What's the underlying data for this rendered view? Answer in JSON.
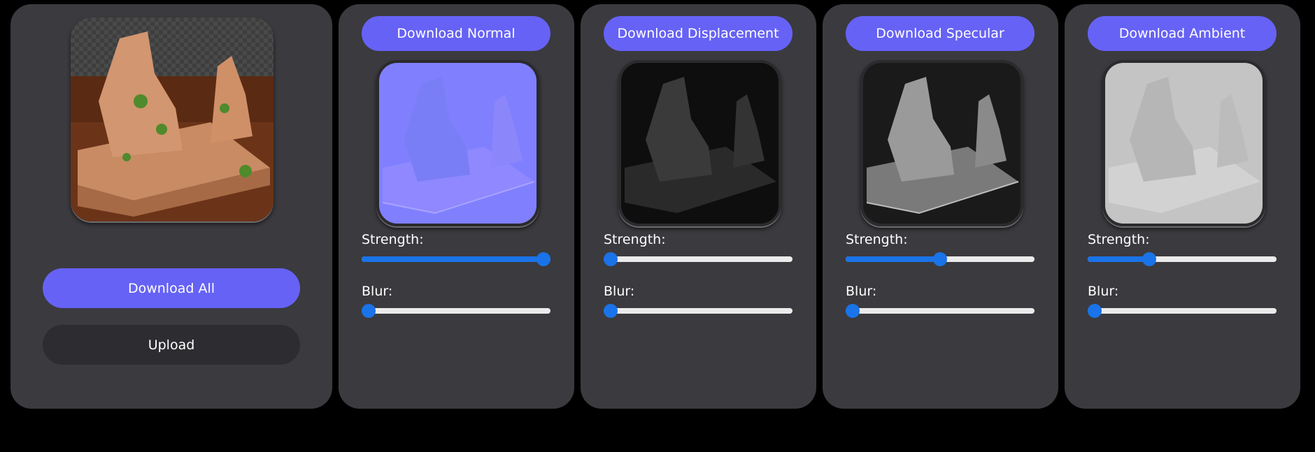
{
  "source_panel": {
    "download_all_label": "Download All",
    "upload_label": "Upload"
  },
  "common": {
    "strength_label": "Strength:",
    "blur_label": "Blur:"
  },
  "maps": [
    {
      "key": "normal",
      "button_label": "Download Normal",
      "strength": 1.0,
      "blur": 0.0
    },
    {
      "key": "displacement",
      "button_label": "Download Displacement",
      "strength": 0.0,
      "blur": 0.0
    },
    {
      "key": "specular",
      "button_label": "Download Specular",
      "strength": 0.5,
      "blur": 0.0
    },
    {
      "key": "ambient",
      "button_label": "Download Ambient",
      "strength": 0.31,
      "blur": 0.0
    }
  ],
  "colors": {
    "accent": "#6662f5",
    "slider_fill": "#1a73e8",
    "panel_bg": "#3b3a3e",
    "page_bg": "#000000"
  }
}
